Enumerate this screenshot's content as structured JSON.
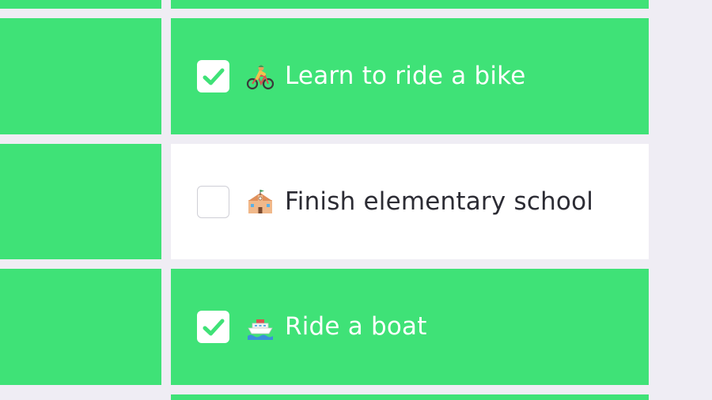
{
  "colors": {
    "done_bg": "#3fe277",
    "todo_bg": "#ffffff",
    "page_bg": "#efedf4",
    "check_mark": "#3fe277"
  },
  "tasks": [
    {
      "label": "Learn to ride a bike",
      "icon": "bicycle-rider-icon",
      "checked": true
    },
    {
      "label": "Finish elementary school",
      "icon": "school-building-icon",
      "checked": false
    },
    {
      "label": "Ride a boat",
      "icon": "ship-icon",
      "checked": true
    }
  ]
}
